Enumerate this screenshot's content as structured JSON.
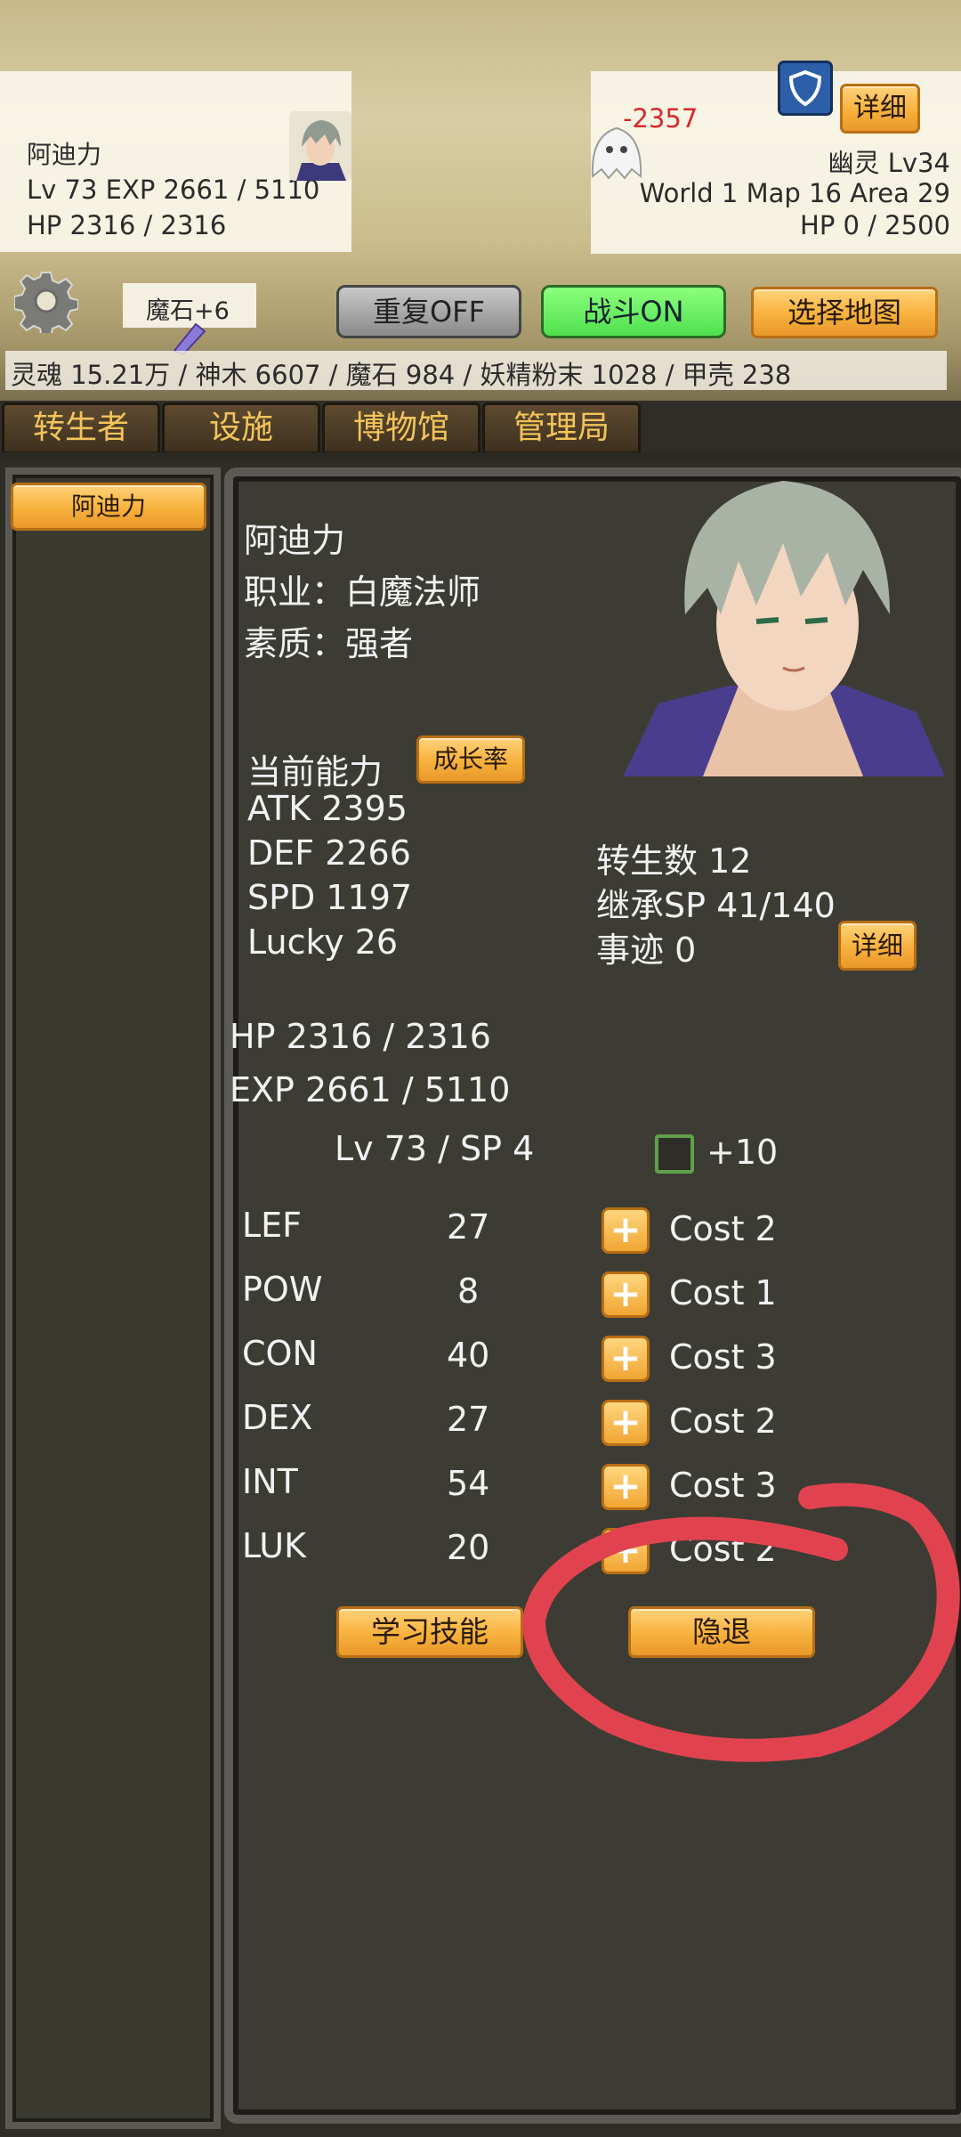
{
  "player": {
    "name": "阿迪力",
    "lv_exp": "Lv 73 EXP 2661 / 5110",
    "hp": "HP 2316 / 2316"
  },
  "enemy": {
    "damage": "-2357",
    "name": "幽灵 Lv34",
    "location": "World 1 Map 16 Area 29",
    "hp": "HP 0 / 2500",
    "detail_label": "详细"
  },
  "toolbar": {
    "magic_stone": "魔石+6",
    "repeat_label": "重复OFF",
    "battle_label": "战斗ON",
    "select_map_label": "选择地图"
  },
  "resources": "灵魂 15.21万 / 神木 6607 / 魔石 984 / 妖精粉末 1028 / 甲壳 238",
  "tabs": [
    "转生者",
    "设施",
    "博物馆",
    "管理局"
  ],
  "sidebar": {
    "items": [
      {
        "label": "阿迪力"
      }
    ]
  },
  "character": {
    "name": "阿迪力",
    "job": "职业：白魔法师",
    "quality": "素质：强者",
    "ability_title": "当前能力",
    "growth_button": "成长率",
    "atk": "ATK 2395",
    "def": "DEF 2266",
    "spd": "SPD 1197",
    "lucky": "Lucky 26",
    "rebirth": "转生数 12",
    "inherit_sp": "继承SP 41/140",
    "deeds": "事迹 0",
    "detail_label": "详细",
    "hp": "HP 2316 / 2316",
    "exp": "EXP 2661 / 5110",
    "lv_sp": "Lv 73 / SP 4",
    "plus10": "+10",
    "stats": [
      {
        "name": "LEF",
        "value": "27",
        "cost": "Cost 2"
      },
      {
        "name": "POW",
        "value": "8",
        "cost": "Cost 1"
      },
      {
        "name": "CON",
        "value": "40",
        "cost": "Cost 3"
      },
      {
        "name": "DEX",
        "value": "27",
        "cost": "Cost 2"
      },
      {
        "name": "INT",
        "value": "54",
        "cost": "Cost 3"
      },
      {
        "name": "LUK",
        "value": "20",
        "cost": "Cost 2"
      }
    ],
    "learn_skill_label": "学习技能",
    "retire_label": "隐退"
  },
  "colors": {
    "accent": "#f7b13c",
    "damage": "#d42a2a",
    "annotation": "#e0434f",
    "panel": "#3d3c34"
  }
}
